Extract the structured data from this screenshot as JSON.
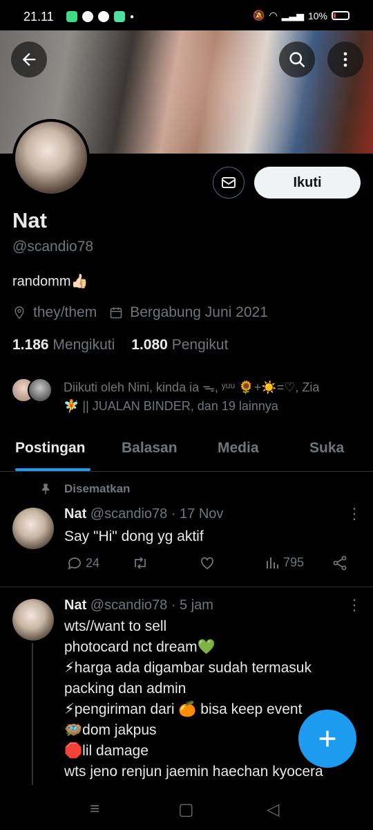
{
  "status_bar": {
    "time": "21.11",
    "battery": "10%"
  },
  "header": {
    "back_icon": "arrow-left-icon",
    "search_icon": "search-icon",
    "more_icon": "more-vertical-icon"
  },
  "profile": {
    "name": "Nat",
    "handle": "@scandio78",
    "bio": "randomm👍🏻",
    "pronouns": "they/them",
    "joined": "Bergabung Juni 2021",
    "following_count": "1.186",
    "following_label": "Mengikuti",
    "followers_count": "1.080",
    "followers_label": "Pengikut",
    "follow_button": "Ikuti",
    "followed_by_line1": "Diikuti oleh Nini, kinda ia ᯓ, ʸᵘᵘ 🌻+☀️=♡, Zia",
    "followed_by_line2": "🧚 || JUALAN BINDER, dan 19 lainnya"
  },
  "tabs": [
    {
      "label": "Postingan"
    },
    {
      "label": "Balasan"
    },
    {
      "label": "Media"
    },
    {
      "label": "Suka"
    }
  ],
  "pinned_label": "Disematkan",
  "tweets": [
    {
      "name": "Nat",
      "handle": "@scandio78",
      "time": "· 17 Nov",
      "text": "Say \"Hi\" dong yg aktif",
      "replies": "24",
      "views": "795"
    },
    {
      "name": "Nat",
      "handle": "@scandio78",
      "time": "· 5 jam",
      "text": "wts//want to sell\nphotocard nct dream💚\n⚡harga ada digambar sudah termasuk\npacking dan admin\n⚡pengiriman dari 🍊 bisa keep event\n🪺dom jakpus\n🛑lil damage\nwts jeno renjun jaemin haechan kyocera"
    }
  ],
  "fab_icon": "plus-icon",
  "colors": {
    "accent": "#1d9bf0",
    "background": "#000000",
    "muted": "#71767b"
  }
}
